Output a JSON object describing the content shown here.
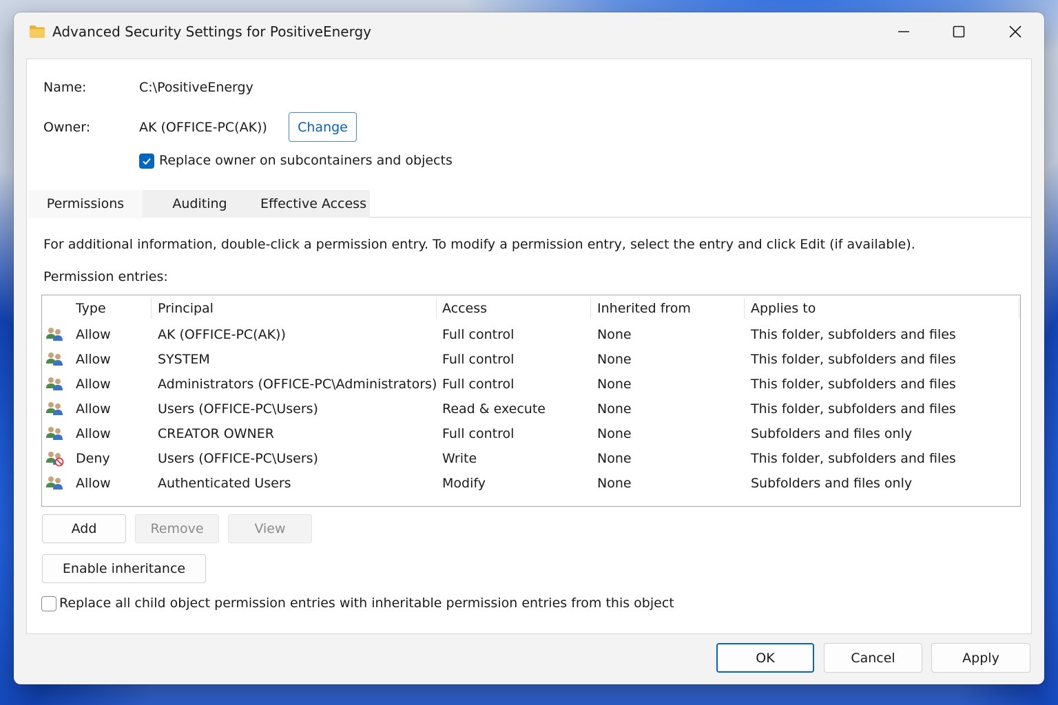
{
  "window": {
    "title": "Advanced Security Settings for PositiveEnergy"
  },
  "details": {
    "name_label": "Name:",
    "name_value": "C:\\PositiveEnergy",
    "owner_label": "Owner:",
    "owner_value": "AK (OFFICE-PC(AK))",
    "change_label": "Change",
    "replace_owner_label": "Replace owner on subcontainers and objects",
    "replace_owner_checked": true
  },
  "tabs": [
    {
      "label": "Permissions",
      "active": true
    },
    {
      "label": "Auditing",
      "active": false
    },
    {
      "label": "Effective Access",
      "active": false
    }
  ],
  "info_text": "For additional information, double-click a permission entry. To modify a permission entry, select the entry and click Edit (if available).",
  "entries_label": "Permission entries:",
  "table": {
    "columns": [
      "Type",
      "Principal",
      "Access",
      "Inherited from",
      "Applies to"
    ],
    "rows": [
      {
        "icon": "users-icon",
        "type": "Allow",
        "principal": "AK (OFFICE-PC(AK))",
        "access": "Full control",
        "inherited": "None",
        "applies": "This folder, subfolders and files"
      },
      {
        "icon": "users-icon",
        "type": "Allow",
        "principal": "SYSTEM",
        "access": "Full control",
        "inherited": "None",
        "applies": "This folder, subfolders and files"
      },
      {
        "icon": "users-icon",
        "type": "Allow",
        "principal": "Administrators (OFFICE-PC\\Administrators)",
        "access": "Full control",
        "inherited": "None",
        "applies": "This folder, subfolders and files"
      },
      {
        "icon": "users-icon",
        "type": "Allow",
        "principal": "Users (OFFICE-PC\\Users)",
        "access": "Read & execute",
        "inherited": "None",
        "applies": "This folder, subfolders and files"
      },
      {
        "icon": "users-icon",
        "type": "Allow",
        "principal": "CREATOR OWNER",
        "access": "Full control",
        "inherited": "None",
        "applies": "Subfolders and files only"
      },
      {
        "icon": "users-deny-icon",
        "type": "Deny",
        "principal": "Users (OFFICE-PC\\Users)",
        "access": "Write",
        "inherited": "None",
        "applies": "This folder, subfolders and files"
      },
      {
        "icon": "users-icon",
        "type": "Allow",
        "principal": "Authenticated Users",
        "access": "Modify",
        "inherited": "None",
        "applies": "Subfolders and files only"
      }
    ]
  },
  "actions": {
    "add": "Add",
    "remove": "Remove",
    "view": "View",
    "enable_inheritance": "Enable inheritance"
  },
  "replace_child_label": "Replace all child object permission entries with inheritable permission entries from this object",
  "replace_child_checked": false,
  "footer": {
    "ok": "OK",
    "cancel": "Cancel",
    "apply": "Apply"
  },
  "colors": {
    "accent": "#0067c0",
    "folder": "#f2c14e",
    "deny": "#d9363e"
  }
}
